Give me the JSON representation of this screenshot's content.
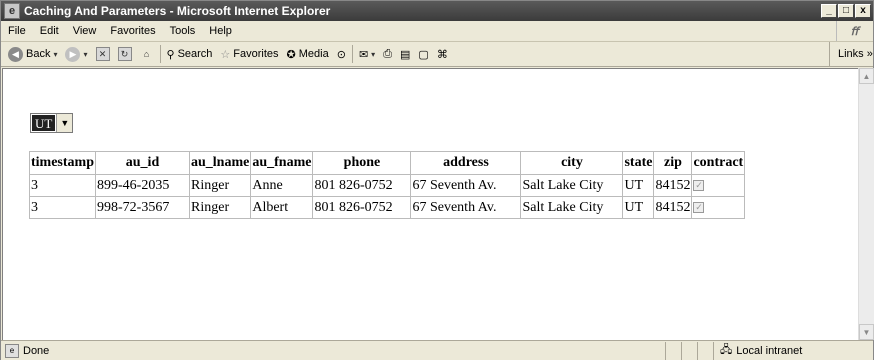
{
  "window": {
    "title": "Caching And Parameters - Microsoft Internet Explorer",
    "minimize": "_",
    "maximize": "□",
    "close": "x"
  },
  "menu": {
    "items": [
      {
        "label": "File"
      },
      {
        "label": "Edit"
      },
      {
        "label": "View"
      },
      {
        "label": "Favorites"
      },
      {
        "label": "Tools"
      },
      {
        "label": "Help"
      }
    ]
  },
  "toolbar": {
    "back": "Back",
    "search": "Search",
    "favorites": "Favorites",
    "media": "Media",
    "links": "Links"
  },
  "page": {
    "state_select": {
      "value": "UT"
    },
    "table": {
      "columns": [
        "timestamp",
        "au_id",
        "au_lname",
        "au_fname",
        "phone",
        "address",
        "city",
        "state",
        "zip",
        "contract"
      ],
      "rows": [
        {
          "timestamp": "3",
          "au_id": "899-46-2035",
          "au_lname": "Ringer",
          "au_fname": "Anne",
          "phone": "801 826-0752",
          "address": "67 Seventh Av.",
          "city": "Salt Lake City",
          "state": "UT",
          "zip": "84152",
          "contract": true
        },
        {
          "timestamp": "3",
          "au_id": "998-72-3567",
          "au_lname": "Ringer",
          "au_fname": "Albert",
          "phone": "801 826-0752",
          "address": "67 Seventh Av.",
          "city": "Salt Lake City",
          "state": "UT",
          "zip": "84152",
          "contract": true
        }
      ]
    }
  },
  "status": {
    "text": "Done",
    "zone": "Local intranet"
  },
  "icons": {
    "app": "ie-page-icon",
    "back": "back-arrow-icon",
    "forward": "forward-arrow-icon",
    "stop": "stop-icon",
    "refresh": "refresh-icon",
    "home": "home-icon",
    "search": "search-icon",
    "favorites": "star-icon",
    "media": "media-icon",
    "history": "history-icon",
    "mail": "mail-icon",
    "print": "print-icon",
    "edit": "edit-icon",
    "discuss": "discuss-icon",
    "messenger": "messenger-icon"
  }
}
